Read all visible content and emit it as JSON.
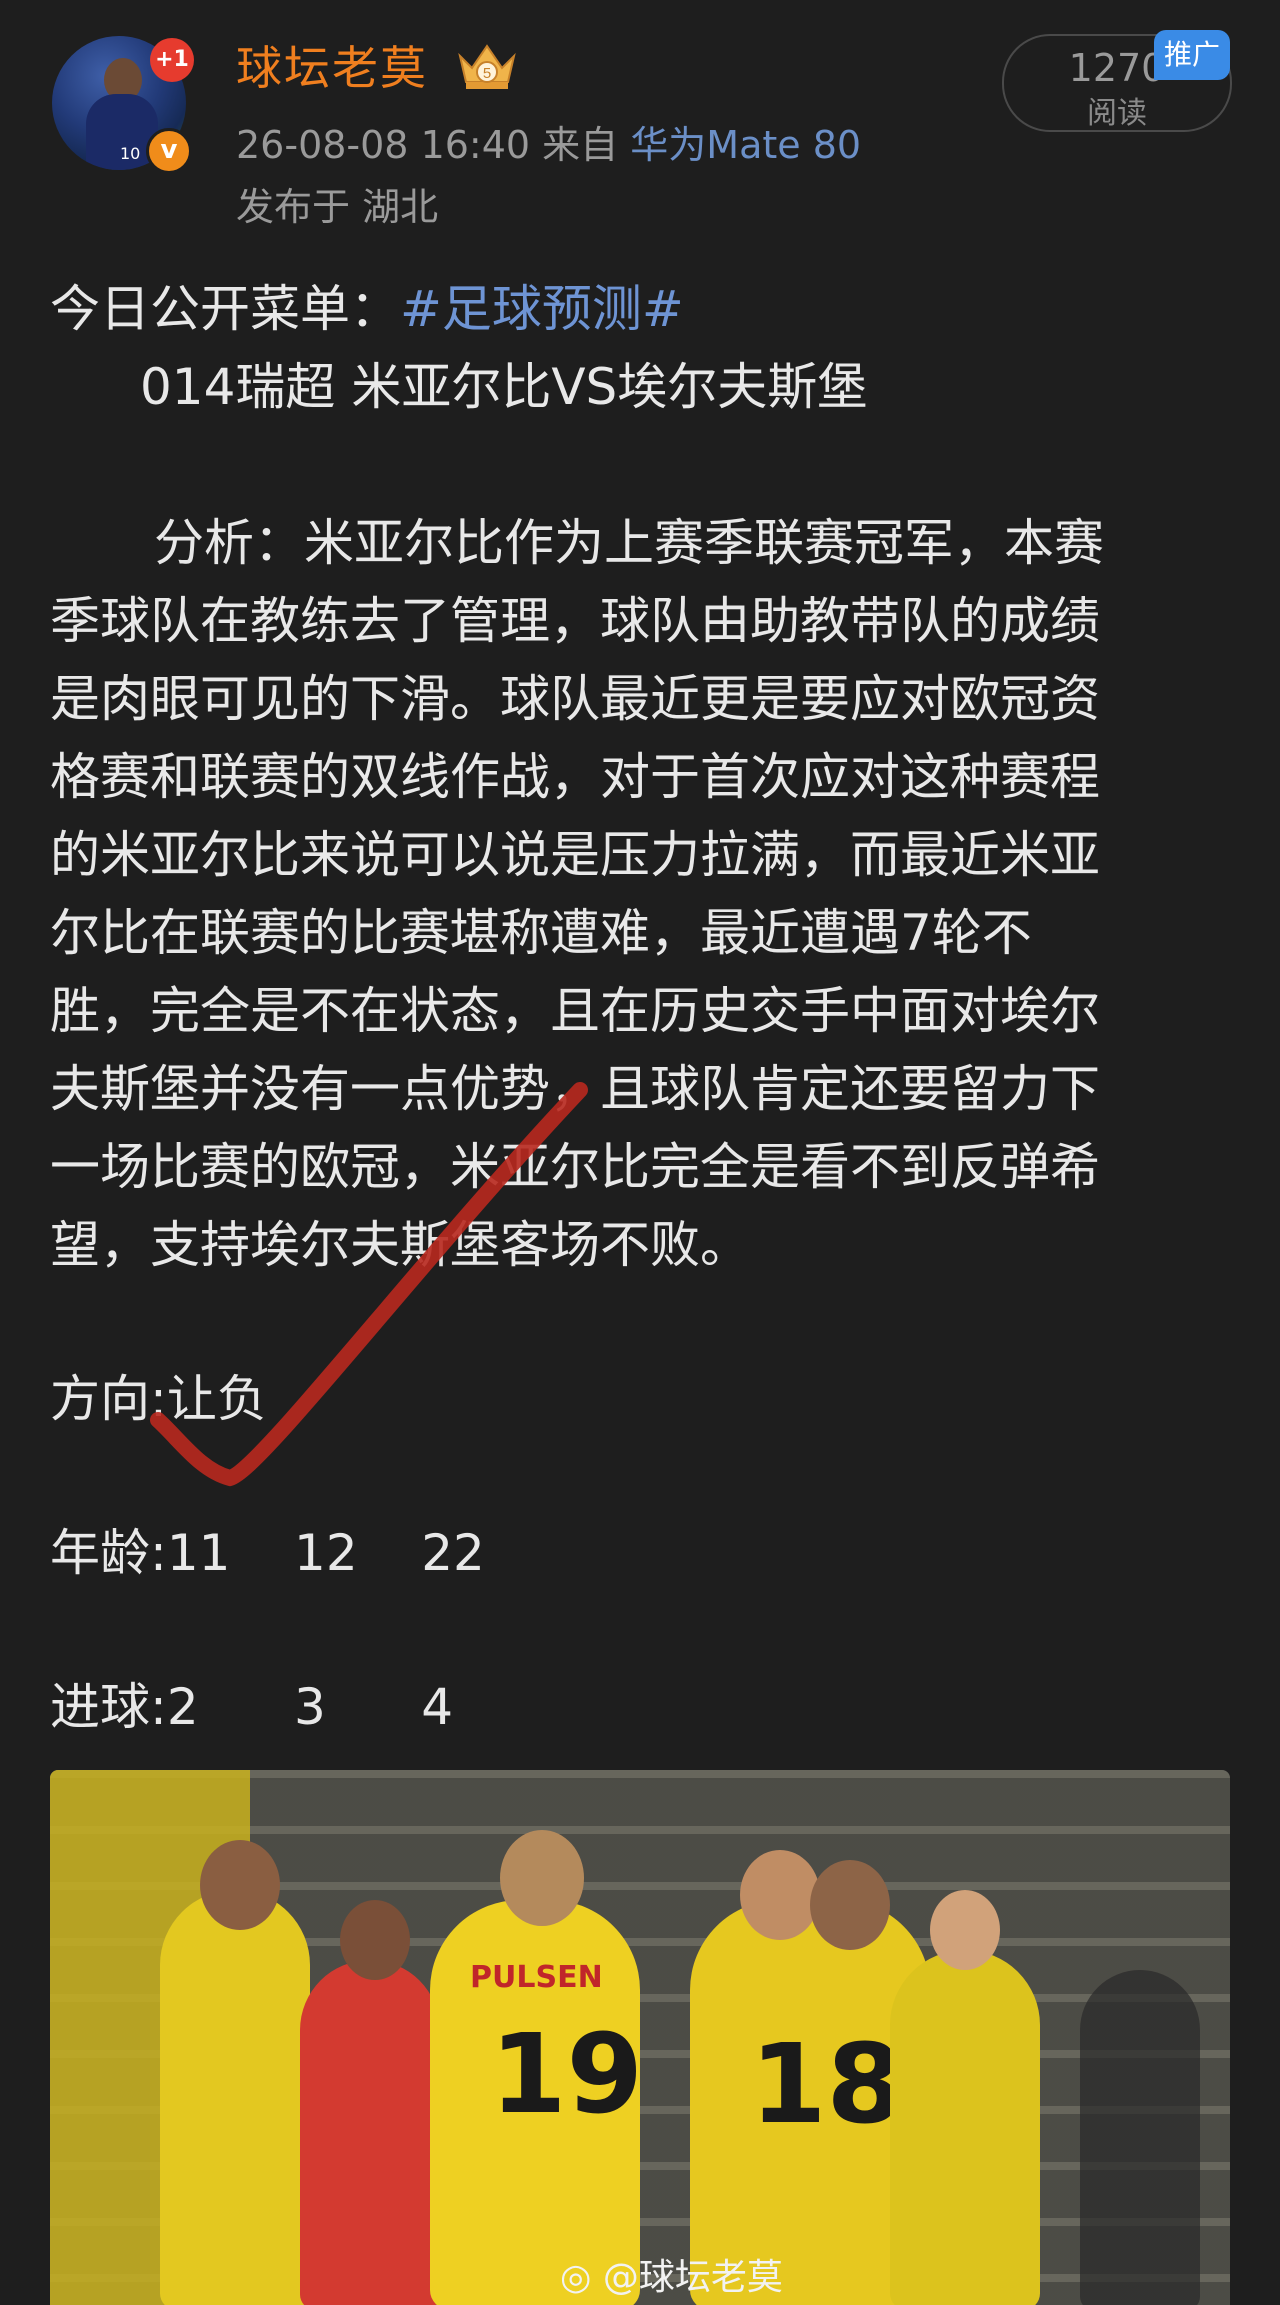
{
  "header": {
    "avatar_badge": "+1",
    "verified_badge": "v",
    "username": "球坛老莫",
    "crown_level": "5",
    "timestamp": "26-08-08 16:40",
    "source_prefix": "来自",
    "device": "华为Mate 80",
    "location": "发布于 湖北",
    "reads_count": "1270",
    "reads_label": "阅读",
    "promo_label": "推广",
    "avatar_jersey_number": "10"
  },
  "post": {
    "menu_prefix": "今日公开菜单：",
    "hashtag": "#足球预测#",
    "match": "014瑞超 米亚尔比VS埃尔夫斯堡",
    "analysis_lines": [
      "分析：米亚尔比作为上赛季联赛冠军，本赛",
      "季球队在教练去了管理，球队由助教带队的成绩",
      "是肉眼可见的下滑。球队最近更是要应对欧冠资",
      "格赛和联赛的双线作战，对于首次应对这种赛程",
      "的米亚尔比来说可以说是压力拉满，而最近米亚",
      "尔比在联赛的比赛堪称遭难，最近遭遇7轮不",
      "胜，完全是不在状态，且在历史交手中面对埃尔",
      "夫斯堡并没有一点优势，且球队肯定还要留力下",
      "一场比赛的欧冠，米亚尔比完全是看不到反弹希",
      "望，支持埃尔夫斯堡客场不败。"
    ],
    "direction": "方向:让负",
    "age": "年龄:11    12    22",
    "goals": "进球:2      3      4"
  },
  "image": {
    "sponsor": "PULSEN",
    "numbers": [
      "19",
      "18"
    ],
    "watermark": "@球坛老莫"
  },
  "colors": {
    "background": "#1e1e1e",
    "username": "#f07f1f",
    "link": "#6e94d4",
    "checkmark": "#b8281e",
    "promo": "#3a8be6"
  }
}
